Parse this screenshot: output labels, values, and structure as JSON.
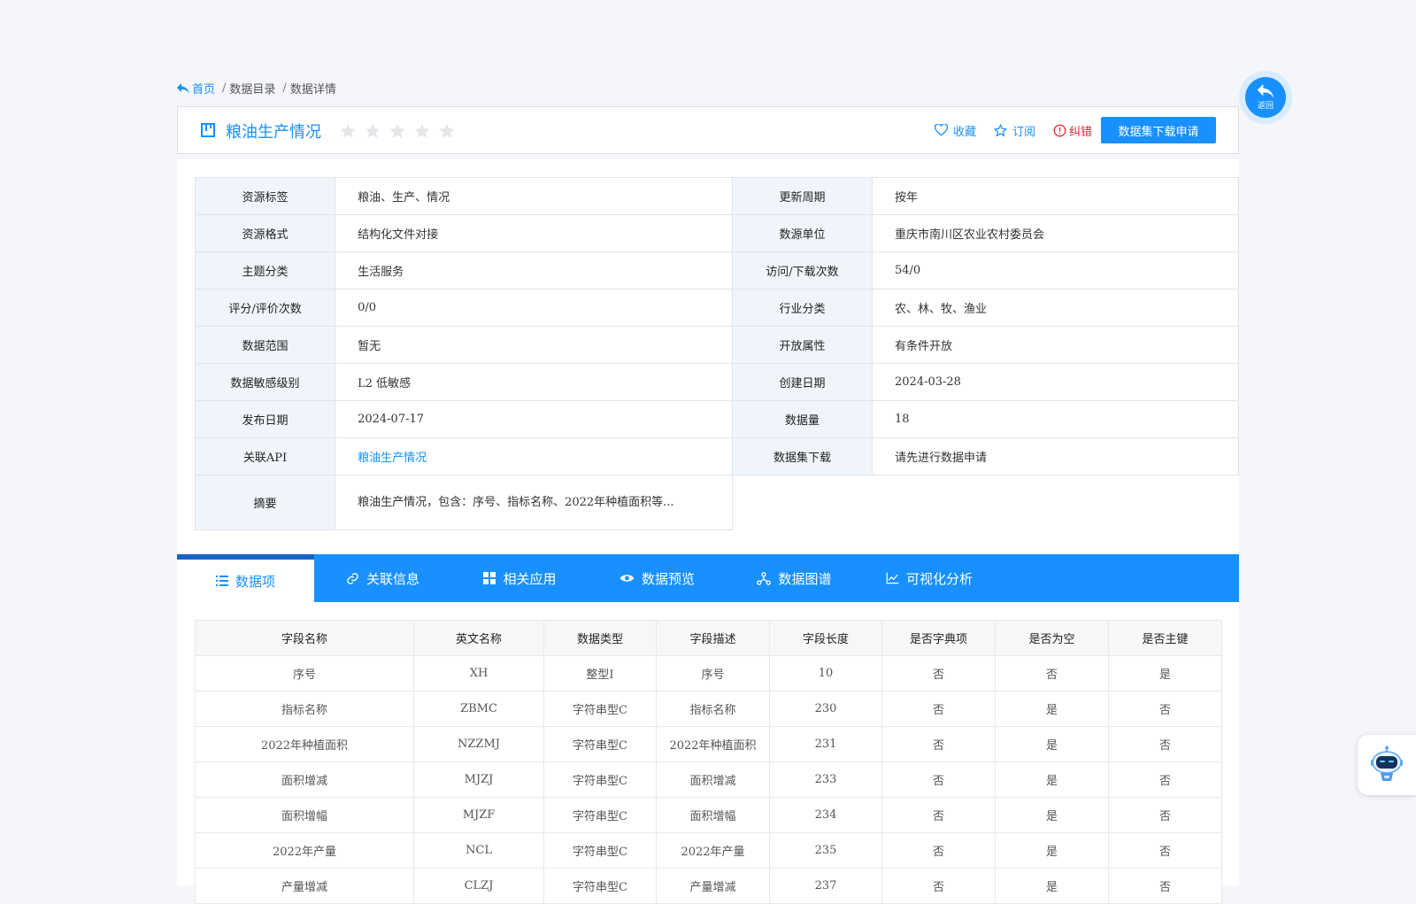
{
  "breadcrumb": {
    "home": "首页",
    "catalog": "数据目录",
    "detail": "数据详情",
    "sep": "/"
  },
  "header": {
    "title": "粮油生产情况",
    "favorite": "收藏",
    "subscribe": "订阅",
    "report_error": "纠错",
    "apply_button": "数据集下载申请",
    "rating": 0
  },
  "back": {
    "label": "返回"
  },
  "info": {
    "rows": [
      {
        "k1": "资源标签",
        "v1": "粮油、生产、情况",
        "k2": "更新周期",
        "v2": "按年"
      },
      {
        "k1": "资源格式",
        "v1": "结构化文件对接",
        "k2": "数源单位",
        "v2": "重庆市南川区农业农村委员会"
      },
      {
        "k1": "主题分类",
        "v1": "生活服务",
        "k2": "访问/下载次数",
        "v2": "54/0"
      },
      {
        "k1": "评分/评价次数",
        "v1": "0/0",
        "k2": "行业分类",
        "v2": "农、林、牧、渔业"
      },
      {
        "k1": "数据范围",
        "v1": "暂无",
        "k2": "开放属性",
        "v2": "有条件开放"
      },
      {
        "k1": "数据敏感级别",
        "v1": "L2 低敏感",
        "k2": "创建日期",
        "v2": "2024-03-28"
      },
      {
        "k1": "发布日期",
        "v1": "2024-07-17",
        "k2": "数据量",
        "v2": "18"
      },
      {
        "k1": "关联API",
        "v1": "粮油生产情况",
        "k2": "数据集下载",
        "v2": "请先进行数据申请"
      }
    ],
    "summary_label": "摘要",
    "summary": "粮油生产情况，包含：序号、指标名称、2022年种植面积等..."
  },
  "tabs": [
    "数据项",
    "关联信息",
    "相关应用",
    "数据预览",
    "数据图谱",
    "可视化分析"
  ],
  "fields": {
    "headers": [
      "字段名称",
      "英文名称",
      "数据类型",
      "字段描述",
      "字段长度",
      "是否字典项",
      "是否为空",
      "是否主键"
    ],
    "rows": [
      [
        "序号",
        "XH",
        "整型I",
        "序号",
        "10",
        "否",
        "否",
        "是"
      ],
      [
        "指标名称",
        "ZBMC",
        "字符串型C",
        "指标名称",
        "230",
        "否",
        "是",
        "否"
      ],
      [
        "2022年种植面积",
        "NZZMJ",
        "字符串型C",
        "2022年种植面积",
        "231",
        "否",
        "是",
        "否"
      ],
      [
        "面积增减",
        "MJZJ",
        "字符串型C",
        "面积增减",
        "233",
        "否",
        "是",
        "否"
      ],
      [
        "面积增幅",
        "MJZF",
        "字符串型C",
        "面积增幅",
        "234",
        "否",
        "是",
        "否"
      ],
      [
        "2022年产量",
        "NCL",
        "字符串型C",
        "2022年产量",
        "235",
        "否",
        "是",
        "否"
      ],
      [
        "产量增减",
        "CLZJ",
        "字符串型C",
        "产量增减",
        "237",
        "否",
        "是",
        "否"
      ]
    ]
  },
  "colors": {
    "primary": "#1890ff",
    "danger": "#e6202f",
    "key_bg": "#f0f5fb"
  }
}
